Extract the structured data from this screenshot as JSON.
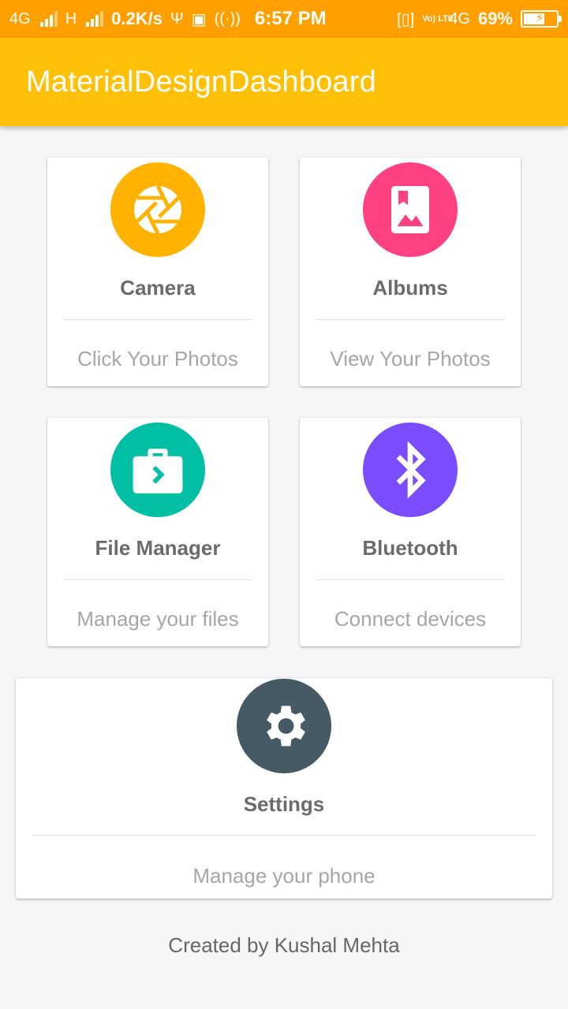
{
  "status_bar": {
    "network1": "4G",
    "network2": "H",
    "speed": "0.2K/s",
    "usb_icon": "usb-icon",
    "vpn_icon": "vpn-key-icon",
    "hotspot_icon": "hotspot-icon",
    "time": "6:57 PM",
    "vibrate_icon": "vibrate-icon",
    "volte": "Vo) LTE",
    "network3": "4G",
    "battery": "69%",
    "battery_level": 0.69
  },
  "app_bar": {
    "title": "MaterialDesignDashboard",
    "color": "#ffc107"
  },
  "cards": [
    {
      "title": "Camera",
      "subtitle": "Click Your Photos",
      "icon": "camera-aperture-icon",
      "color": "#ffb300"
    },
    {
      "title": "Albums",
      "subtitle": "View Your Photos",
      "icon": "photo-album-icon",
      "color": "#ff4081"
    },
    {
      "title": "File Manager",
      "subtitle": "Manage your files",
      "icon": "briefcase-icon",
      "color": "#00bfa5"
    },
    {
      "title": "Bluetooth",
      "subtitle": "Connect devices",
      "icon": "bluetooth-icon",
      "color": "#7c4dff"
    },
    {
      "title": "Settings",
      "subtitle": "Manage your phone",
      "icon": "gear-icon",
      "color": "#455a64"
    }
  ],
  "footer": {
    "text": "Created by Kushal Mehta"
  }
}
